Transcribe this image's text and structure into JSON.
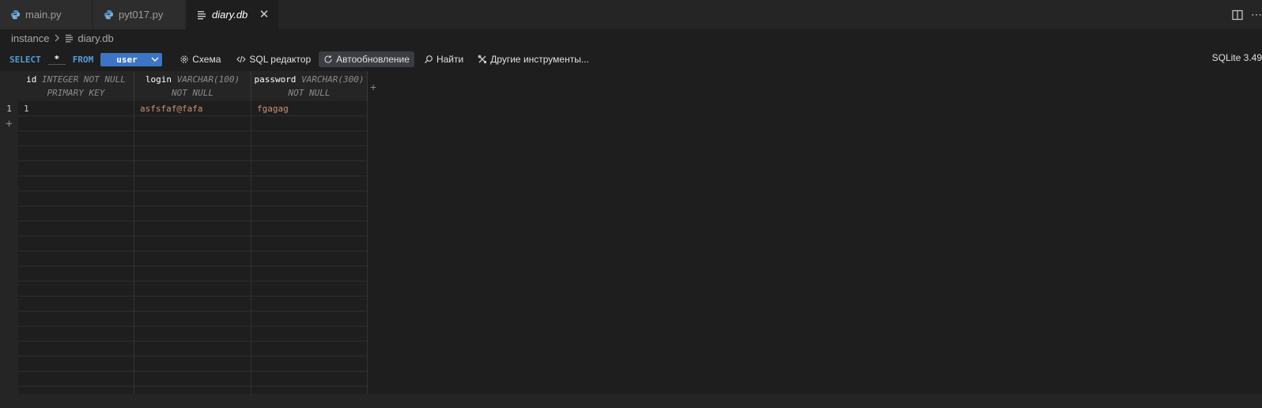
{
  "tabs": [
    {
      "label": "main.py",
      "icon": "python-icon"
    },
    {
      "label": "pyt017.py",
      "icon": "python-icon"
    },
    {
      "label": "diary.db",
      "icon": "database-file-icon",
      "active": true
    }
  ],
  "editor_actions": [
    "split-editor-icon",
    "more-actions-icon"
  ],
  "editor_actions_more": "⋯",
  "breadcrumb": {
    "folder": "instance",
    "file": "diary.db"
  },
  "query": {
    "select": "SELECT",
    "columns": "*",
    "from": "FROM",
    "table": "user"
  },
  "toolbar": {
    "schema": "Схема",
    "sql_editor": "SQL редактор",
    "autorefresh": "Автообновление",
    "find": "Найти",
    "other_tools": "Другие инструменты..."
  },
  "version": "SQLite 3.49",
  "columns": [
    {
      "name": "id",
      "type": "INTEGER NOT NULL",
      "extra": "PRIMARY KEY"
    },
    {
      "name": "login",
      "type": "VARCHAR(100)",
      "extra": "NOT NULL"
    },
    {
      "name": "password",
      "type": "VARCHAR(300)",
      "extra": "NOT NULL"
    }
  ],
  "rows": [
    {
      "rownum": "1",
      "id": "1",
      "login": "asfsfaf@fafa",
      "password": "fgagag"
    }
  ],
  "add_row_symbol": "+",
  "add_column_symbol": "+",
  "colors": {
    "accent": "#3c75c4",
    "id_value": "#b5cea8",
    "string_value": "#ce9178",
    "keyword": "#569cd6"
  }
}
